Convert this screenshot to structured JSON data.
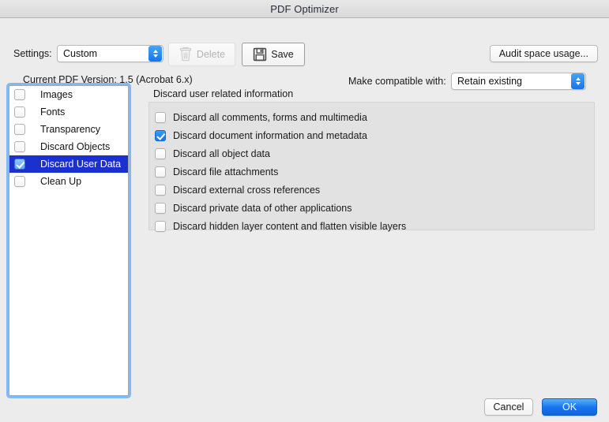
{
  "window": {
    "title": "PDF Optimizer"
  },
  "toolbar": {
    "settings_label": "Settings:",
    "settings_value": "Custom",
    "delete_label": "Delete",
    "delete_enabled": false,
    "save_label": "Save",
    "audit_label": "Audit space usage...",
    "version_text": "Current PDF Version: 1.5 (Acrobat 6.x)",
    "compat_label": "Make compatible with:",
    "compat_value": "Retain existing",
    "icons": {
      "delete": "trash-icon",
      "save": "floppy-disk-icon",
      "popup": "updown-chevron-icon"
    }
  },
  "sidebar": {
    "items": [
      {
        "label": "Images",
        "checked": false,
        "selected": false
      },
      {
        "label": "Fonts",
        "checked": false,
        "selected": false
      },
      {
        "label": "Transparency",
        "checked": false,
        "selected": false
      },
      {
        "label": "Discard Objects",
        "checked": false,
        "selected": false
      },
      {
        "label": "Discard User Data",
        "checked": true,
        "selected": true
      },
      {
        "label": "Clean Up",
        "checked": false,
        "selected": false
      }
    ]
  },
  "main": {
    "group_title": "Discard user related information",
    "options": [
      {
        "label": "Discard all comments, forms and multimedia",
        "checked": false
      },
      {
        "label": "Discard document information and metadata",
        "checked": true
      },
      {
        "label": "Discard all object data",
        "checked": false
      },
      {
        "label": "Discard file attachments",
        "checked": false
      },
      {
        "label": "Discard external cross references",
        "checked": false
      },
      {
        "label": "Discard private data of other applications",
        "checked": false
      },
      {
        "label": "Discard hidden layer content and flatten visible layers",
        "checked": false
      }
    ]
  },
  "footer": {
    "cancel_label": "Cancel",
    "ok_label": "OK"
  },
  "colors": {
    "accent_blue": "#1775ee",
    "selection_blue": "#1a31cf",
    "window_bg": "#ececec",
    "group_bg": "#e2e2e2"
  }
}
